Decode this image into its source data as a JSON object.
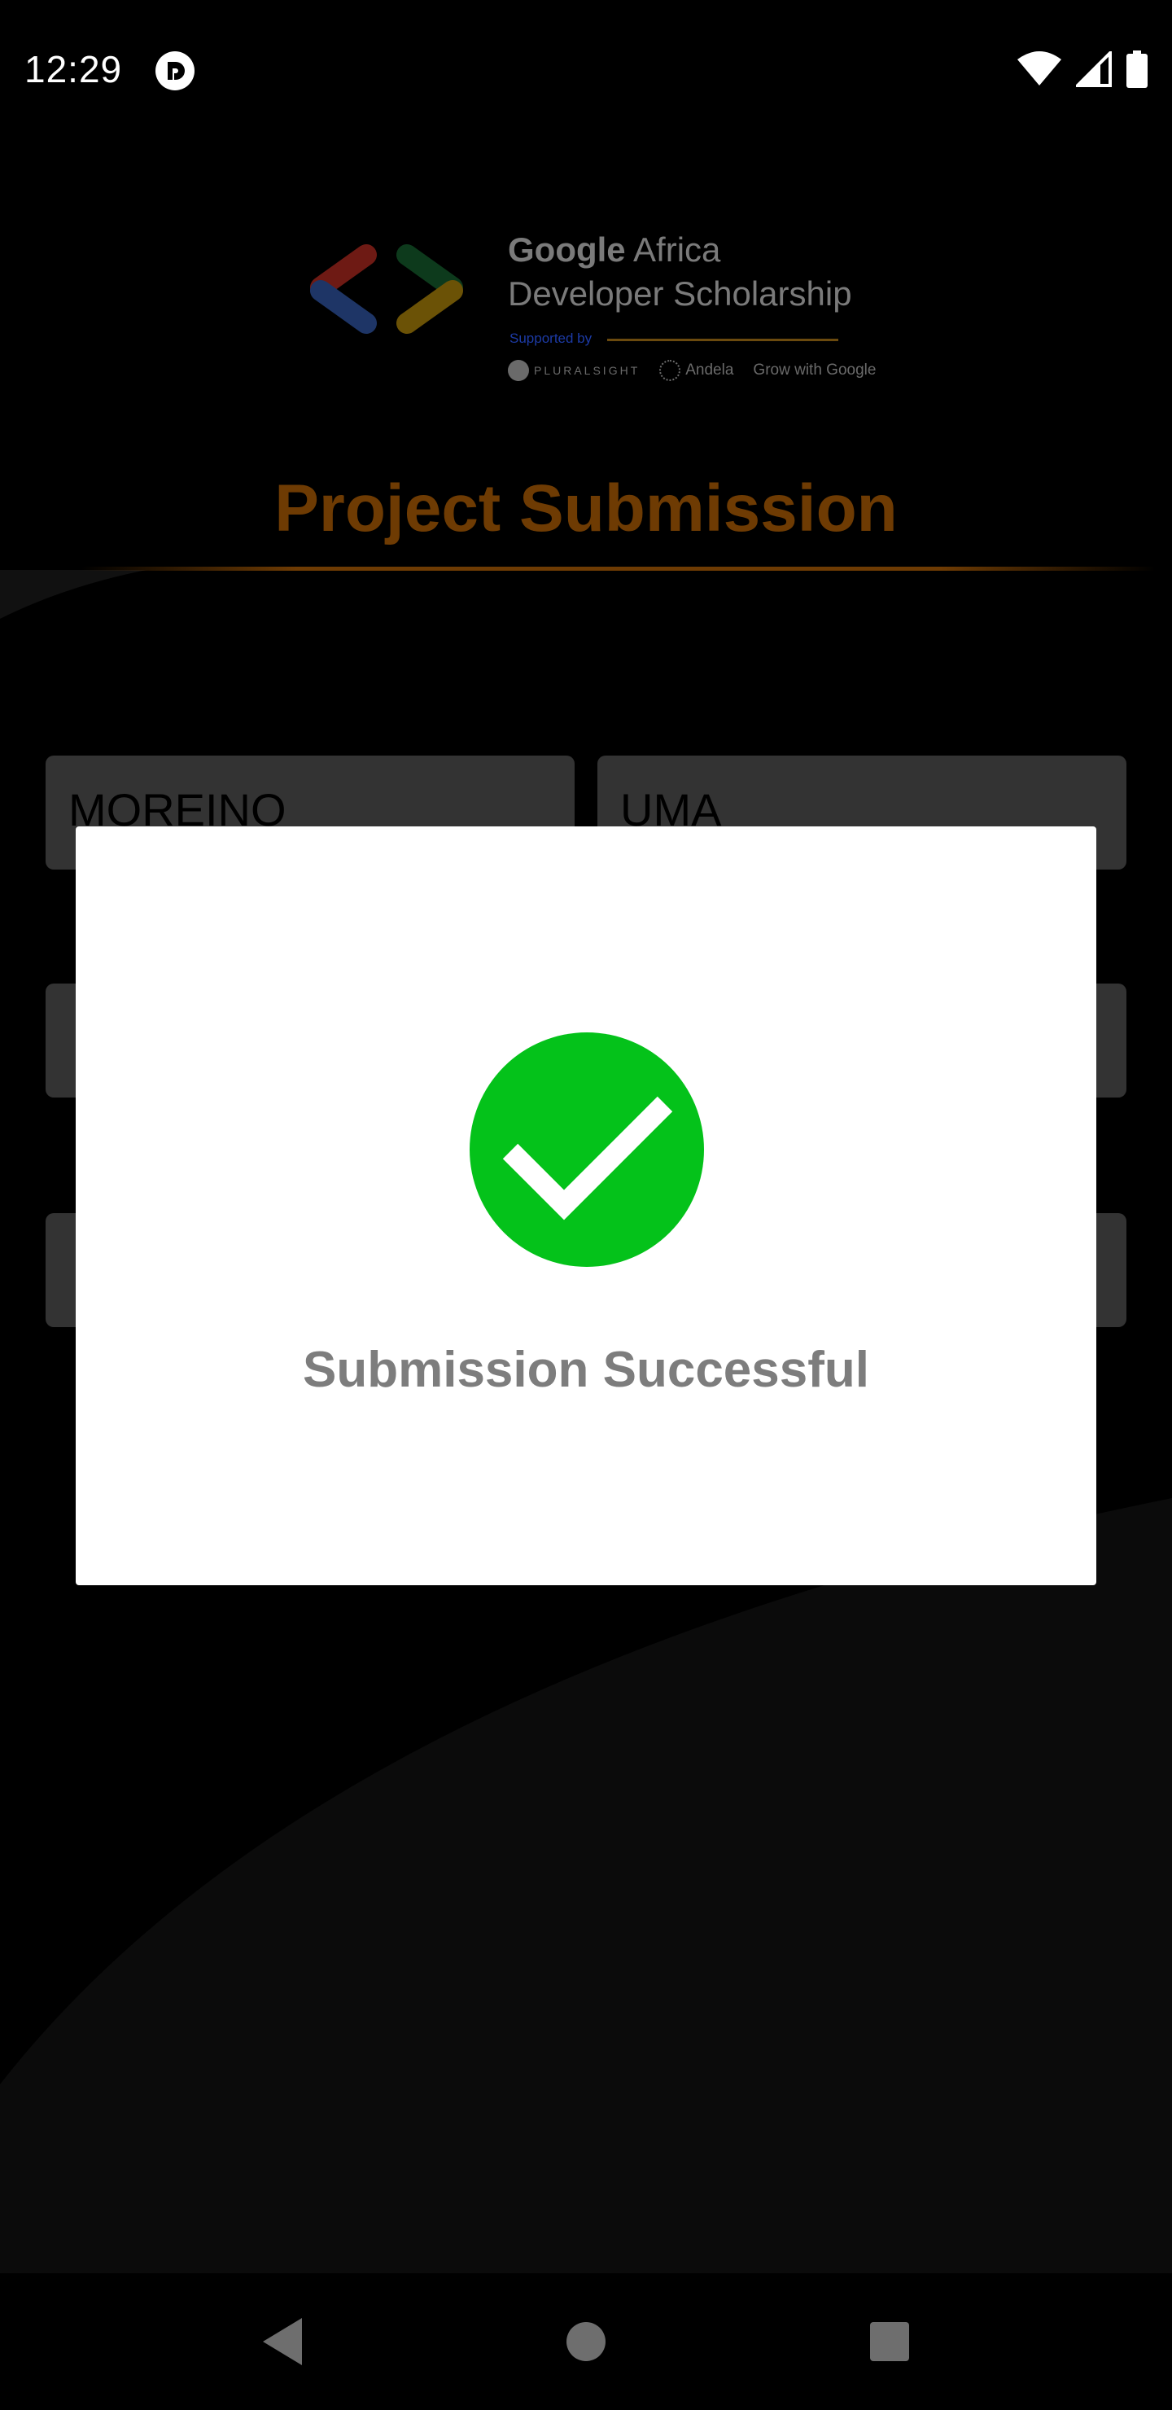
{
  "status_bar": {
    "time": "12:29",
    "app_notification_icon": "pocket-casts-icon",
    "icons": [
      "wifi-icon",
      "cellular-signal-icon",
      "battery-icon"
    ]
  },
  "logo": {
    "title_bold": "Google",
    "title_rest": " Africa",
    "subtitle": "Developer Scholarship",
    "supported_by": "Supported by",
    "partners": [
      "PLURALSIGHT",
      "Andela",
      "Grow with Google"
    ]
  },
  "page": {
    "title": "Project Submission"
  },
  "form": {
    "first_name": "MOREINO",
    "last_name": "UMA",
    "email": "",
    "project_link": ""
  },
  "dialog": {
    "icon": "check-circle-icon",
    "message": "Submission Successful"
  },
  "nav": {
    "back": "back-icon",
    "home": "home-icon",
    "recents": "recents-icon"
  },
  "colors": {
    "title_color": "#6e3b03",
    "success_green": "#04c21a",
    "dialog_text": "#7d7d7d",
    "field_bg": "#333333"
  }
}
